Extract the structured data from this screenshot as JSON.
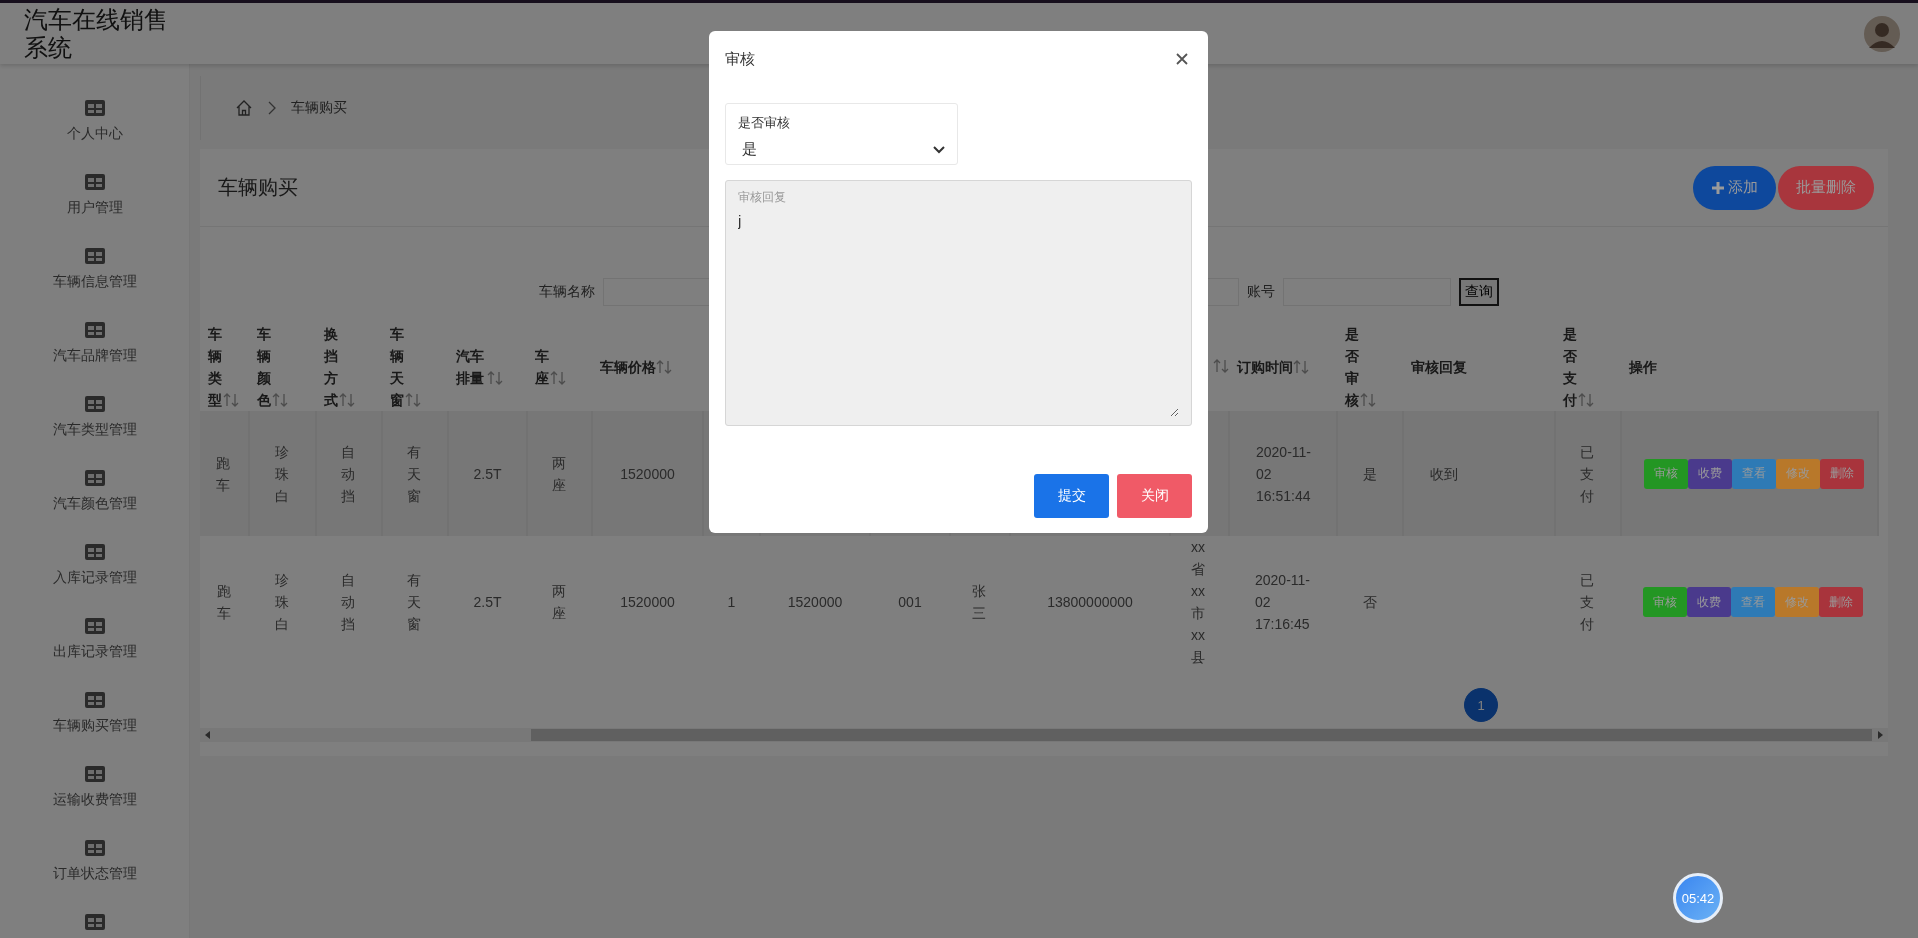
{
  "topbar": {
    "title": "汽车在线销售系统"
  },
  "sidebar": {
    "items": [
      {
        "kind": "labeled",
        "label": "个人中心"
      },
      {
        "kind": "labeled",
        "label": "用户管理"
      },
      {
        "kind": "labeled",
        "label": "车辆信息管理"
      },
      {
        "kind": "labeled",
        "label": "汽车品牌管理"
      },
      {
        "kind": "labeled",
        "label": "汽车类型管理"
      },
      {
        "kind": "labeled",
        "label": "汽车颜色管理"
      },
      {
        "kind": "labeled",
        "label": "入库记录管理"
      },
      {
        "kind": "labeled",
        "label": "出库记录管理"
      },
      {
        "kind": "labeled",
        "label": "车辆购买管理"
      },
      {
        "kind": "labeled",
        "label": "运输收费管理"
      },
      {
        "kind": "labeled",
        "label": "订单状态管理"
      },
      {
        "kind": "icon_only"
      }
    ]
  },
  "breadcrumb": {
    "items": [
      "车辆购买"
    ]
  },
  "card": {
    "title": "车辆购买",
    "buttons": [
      {
        "label": "添加",
        "kind": "add",
        "color": "#0e489c"
      },
      {
        "label": "批量删除",
        "kind": "delete",
        "color": "#a8363d"
      }
    ]
  },
  "search": {
    "fields": [
      {
        "label": "车辆名称"
      },
      {
        "label": "账号"
      }
    ],
    "button": "查询"
  },
  "table": {
    "columns": [
      {
        "label": "车辆类型",
        "sortable": true
      },
      {
        "label": "车辆颜色",
        "sortable": true
      },
      {
        "label": "换挡方式",
        "sortable": true
      },
      {
        "label": "车辆天窗",
        "sortable": true
      },
      {
        "label": "汽车排量",
        "sortable": true
      },
      {
        "label": "车座",
        "sortable": true
      },
      {
        "label": "车辆价格",
        "sortable": true
      },
      null,
      null,
      null,
      null,
      null,
      {
        "sortable": true
      },
      {
        "label": "订购时间",
        "sortable": true
      },
      {
        "label": "是否审核",
        "sortable": true
      },
      {
        "label": "审核回复",
        "sortable": false
      },
      {
        "label": "是否支付",
        "sortable": true
      },
      {
        "label": "操作",
        "sortable": false
      }
    ],
    "rows": [
      {
        "highlighted": true,
        "cells": [
          "跑车",
          "珍珠白",
          "自动挡",
          "有天窗",
          "2.5T",
          "两座",
          "1520000",
          null,
          null,
          null,
          null,
          null,
          null,
          "2020-11-02 16:51:44",
          "是",
          "收到",
          "已支付"
        ],
        "actions": [
          {
            "label": "审核",
            "color": "#239623"
          },
          {
            "label": "收费",
            "color": "#4a3a8c"
          },
          {
            "label": "查看",
            "color": "#2e7ab5"
          },
          {
            "label": "修改",
            "color": "#b8782a"
          },
          {
            "label": "删除",
            "color": "#a8343c"
          }
        ]
      },
      {
        "highlighted": false,
        "cells": [
          "跑车",
          "珍珠白",
          "自动挡",
          "有天窗",
          "2.5T",
          "两座",
          "1520000",
          "1",
          "1520000",
          "001",
          "张三",
          "13800000000",
          "xx省xx市xx县",
          "2020-11-02 17:16:45",
          "否",
          null,
          "已支付"
        ],
        "actions": [
          {
            "label": "审核",
            "color": "#239623"
          },
          {
            "label": "收费",
            "color": "#4a3a8c"
          },
          {
            "label": "查看",
            "color": "#2e7ab5"
          },
          {
            "label": "修改",
            "color": "#b8782a"
          },
          {
            "label": "删除",
            "color": "#a8343c"
          }
        ]
      }
    ]
  },
  "pagination": {
    "pages": [
      {
        "label": "1",
        "selected": true
      }
    ]
  },
  "modal": {
    "title": "审核",
    "select": {
      "label": "是否审核",
      "value": "是"
    },
    "reply": {
      "label": "审核回复",
      "value": "j"
    },
    "buttons": [
      {
        "label": "提交",
        "kind": "primary"
      },
      {
        "label": "关闭",
        "kind": "danger"
      }
    ]
  },
  "timer": {
    "text": "05:42"
  }
}
